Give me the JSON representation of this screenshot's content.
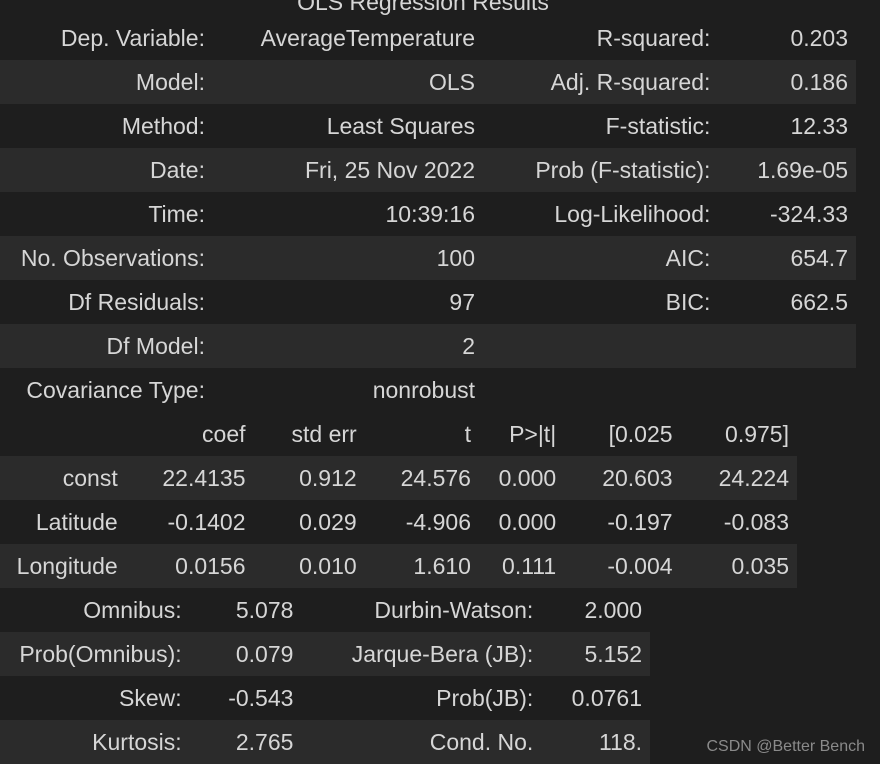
{
  "title": "OLS Regression Results",
  "summary": [
    [
      "Dep. Variable:",
      "AverageTemperature",
      "R-squared:",
      "0.203"
    ],
    [
      "Model:",
      "OLS",
      "Adj. R-squared:",
      "0.186"
    ],
    [
      "Method:",
      "Least Squares",
      "F-statistic:",
      "12.33"
    ],
    [
      "Date:",
      "Fri, 25 Nov 2022",
      "Prob (F-statistic):",
      "1.69e-05"
    ],
    [
      "Time:",
      "10:39:16",
      "Log-Likelihood:",
      "-324.33"
    ],
    [
      "No. Observations:",
      "100",
      "AIC:",
      "654.7"
    ],
    [
      "Df Residuals:",
      "97",
      "BIC:",
      "662.5"
    ],
    [
      "Df Model:",
      "2",
      "",
      ""
    ],
    [
      "Covariance Type:",
      "nonrobust",
      "",
      ""
    ]
  ],
  "coef_table": {
    "headers": [
      "",
      "coef",
      "std err",
      "t",
      "P>|t|",
      "[0.025",
      "0.975]"
    ],
    "rows": [
      [
        "const",
        "22.4135",
        "0.912",
        "24.576",
        "0.000",
        "20.603",
        "24.224"
      ],
      [
        "Latitude",
        "-0.1402",
        "0.029",
        "-4.906",
        "0.000",
        "-0.197",
        "-0.083"
      ],
      [
        "Longitude",
        "0.0156",
        "0.010",
        "1.610",
        "0.111",
        "-0.004",
        "0.035"
      ]
    ]
  },
  "diagnostics": [
    [
      "Omnibus:",
      "5.078",
      "Durbin-Watson:",
      "2.000"
    ],
    [
      "Prob(Omnibus):",
      "0.079",
      "Jarque-Bera (JB):",
      "5.152"
    ],
    [
      "Skew:",
      "-0.543",
      "Prob(JB):",
      "0.0761"
    ],
    [
      "Kurtosis:",
      "2.765",
      "Cond. No.",
      "118."
    ]
  ],
  "watermark": "CSDN @Better Bench"
}
